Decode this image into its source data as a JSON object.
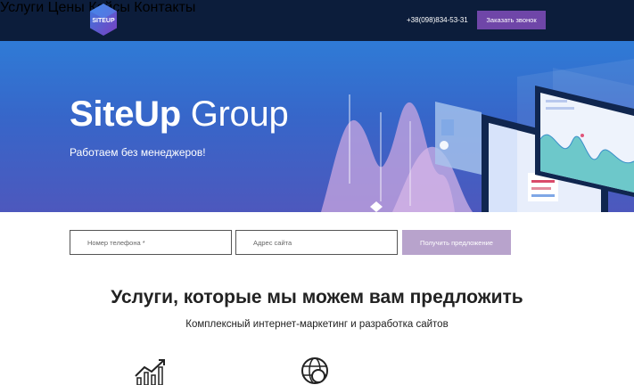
{
  "header": {
    "logo_text": "SITEUP",
    "nav": [
      "Услуги",
      "Цены",
      "Кейсы",
      "Контакты"
    ],
    "phone": "+38(098)834-53-31",
    "callback_label": "Заказать звонок"
  },
  "hero": {
    "title_bold": "SiteUp",
    "title_light": "Group",
    "subtitle": "Работаем без менеджеров!"
  },
  "form": {
    "phone_placeholder": "Номер телефона *",
    "site_placeholder": "Адрес сайта",
    "submit_label": "Получить предложение"
  },
  "services": {
    "title": "Услуги, которые мы можем вам предложить",
    "subtitle": "Комплексный интернет-маркетинг и разработка сайтов",
    "icons": [
      "growth-chart-icon",
      "globe-search-icon"
    ]
  },
  "colors": {
    "header_bg": "#0c1d3b",
    "accent": "#6f46a8",
    "submit_bg": "#b8a3cc",
    "hero_top": "#2f7bd6",
    "hero_bottom": "#4d58bd"
  }
}
